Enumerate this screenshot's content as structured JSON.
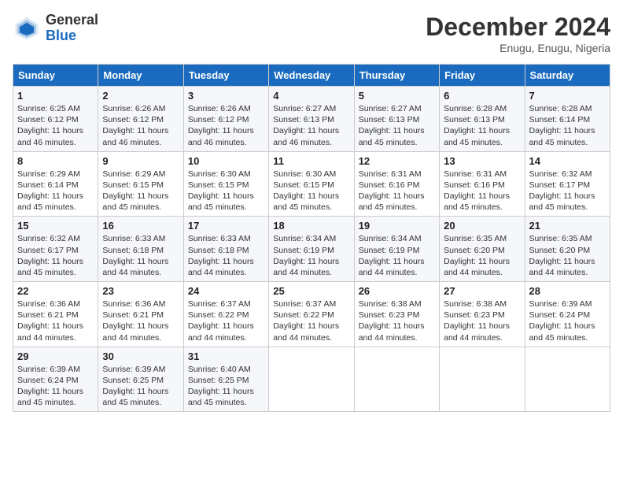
{
  "header": {
    "logo_general": "General",
    "logo_blue": "Blue",
    "month_title": "December 2024",
    "location": "Enugu, Enugu, Nigeria"
  },
  "weekdays": [
    "Sunday",
    "Monday",
    "Tuesday",
    "Wednesday",
    "Thursday",
    "Friday",
    "Saturday"
  ],
  "weeks": [
    [
      {
        "day": "1",
        "sunrise": "6:25 AM",
        "sunset": "6:12 PM",
        "daylight": "11 hours and 46 minutes."
      },
      {
        "day": "2",
        "sunrise": "6:26 AM",
        "sunset": "6:12 PM",
        "daylight": "11 hours and 46 minutes."
      },
      {
        "day": "3",
        "sunrise": "6:26 AM",
        "sunset": "6:12 PM",
        "daylight": "11 hours and 46 minutes."
      },
      {
        "day": "4",
        "sunrise": "6:27 AM",
        "sunset": "6:13 PM",
        "daylight": "11 hours and 46 minutes."
      },
      {
        "day": "5",
        "sunrise": "6:27 AM",
        "sunset": "6:13 PM",
        "daylight": "11 hours and 45 minutes."
      },
      {
        "day": "6",
        "sunrise": "6:28 AM",
        "sunset": "6:13 PM",
        "daylight": "11 hours and 45 minutes."
      },
      {
        "day": "7",
        "sunrise": "6:28 AM",
        "sunset": "6:14 PM",
        "daylight": "11 hours and 45 minutes."
      }
    ],
    [
      {
        "day": "8",
        "sunrise": "6:29 AM",
        "sunset": "6:14 PM",
        "daylight": "11 hours and 45 minutes."
      },
      {
        "day": "9",
        "sunrise": "6:29 AM",
        "sunset": "6:15 PM",
        "daylight": "11 hours and 45 minutes."
      },
      {
        "day": "10",
        "sunrise": "6:30 AM",
        "sunset": "6:15 PM",
        "daylight": "11 hours and 45 minutes."
      },
      {
        "day": "11",
        "sunrise": "6:30 AM",
        "sunset": "6:15 PM",
        "daylight": "11 hours and 45 minutes."
      },
      {
        "day": "12",
        "sunrise": "6:31 AM",
        "sunset": "6:16 PM",
        "daylight": "11 hours and 45 minutes."
      },
      {
        "day": "13",
        "sunrise": "6:31 AM",
        "sunset": "6:16 PM",
        "daylight": "11 hours and 45 minutes."
      },
      {
        "day": "14",
        "sunrise": "6:32 AM",
        "sunset": "6:17 PM",
        "daylight": "11 hours and 45 minutes."
      }
    ],
    [
      {
        "day": "15",
        "sunrise": "6:32 AM",
        "sunset": "6:17 PM",
        "daylight": "11 hours and 45 minutes."
      },
      {
        "day": "16",
        "sunrise": "6:33 AM",
        "sunset": "6:18 PM",
        "daylight": "11 hours and 44 minutes."
      },
      {
        "day": "17",
        "sunrise": "6:33 AM",
        "sunset": "6:18 PM",
        "daylight": "11 hours and 44 minutes."
      },
      {
        "day": "18",
        "sunrise": "6:34 AM",
        "sunset": "6:19 PM",
        "daylight": "11 hours and 44 minutes."
      },
      {
        "day": "19",
        "sunrise": "6:34 AM",
        "sunset": "6:19 PM",
        "daylight": "11 hours and 44 minutes."
      },
      {
        "day": "20",
        "sunrise": "6:35 AM",
        "sunset": "6:20 PM",
        "daylight": "11 hours and 44 minutes."
      },
      {
        "day": "21",
        "sunrise": "6:35 AM",
        "sunset": "6:20 PM",
        "daylight": "11 hours and 44 minutes."
      }
    ],
    [
      {
        "day": "22",
        "sunrise": "6:36 AM",
        "sunset": "6:21 PM",
        "daylight": "11 hours and 44 minutes."
      },
      {
        "day": "23",
        "sunrise": "6:36 AM",
        "sunset": "6:21 PM",
        "daylight": "11 hours and 44 minutes."
      },
      {
        "day": "24",
        "sunrise": "6:37 AM",
        "sunset": "6:22 PM",
        "daylight": "11 hours and 44 minutes."
      },
      {
        "day": "25",
        "sunrise": "6:37 AM",
        "sunset": "6:22 PM",
        "daylight": "11 hours and 44 minutes."
      },
      {
        "day": "26",
        "sunrise": "6:38 AM",
        "sunset": "6:23 PM",
        "daylight": "11 hours and 44 minutes."
      },
      {
        "day": "27",
        "sunrise": "6:38 AM",
        "sunset": "6:23 PM",
        "daylight": "11 hours and 44 minutes."
      },
      {
        "day": "28",
        "sunrise": "6:39 AM",
        "sunset": "6:24 PM",
        "daylight": "11 hours and 45 minutes."
      }
    ],
    [
      {
        "day": "29",
        "sunrise": "6:39 AM",
        "sunset": "6:24 PM",
        "daylight": "11 hours and 45 minutes."
      },
      {
        "day": "30",
        "sunrise": "6:39 AM",
        "sunset": "6:25 PM",
        "daylight": "11 hours and 45 minutes."
      },
      {
        "day": "31",
        "sunrise": "6:40 AM",
        "sunset": "6:25 PM",
        "daylight": "11 hours and 45 minutes."
      },
      null,
      null,
      null,
      null
    ]
  ]
}
